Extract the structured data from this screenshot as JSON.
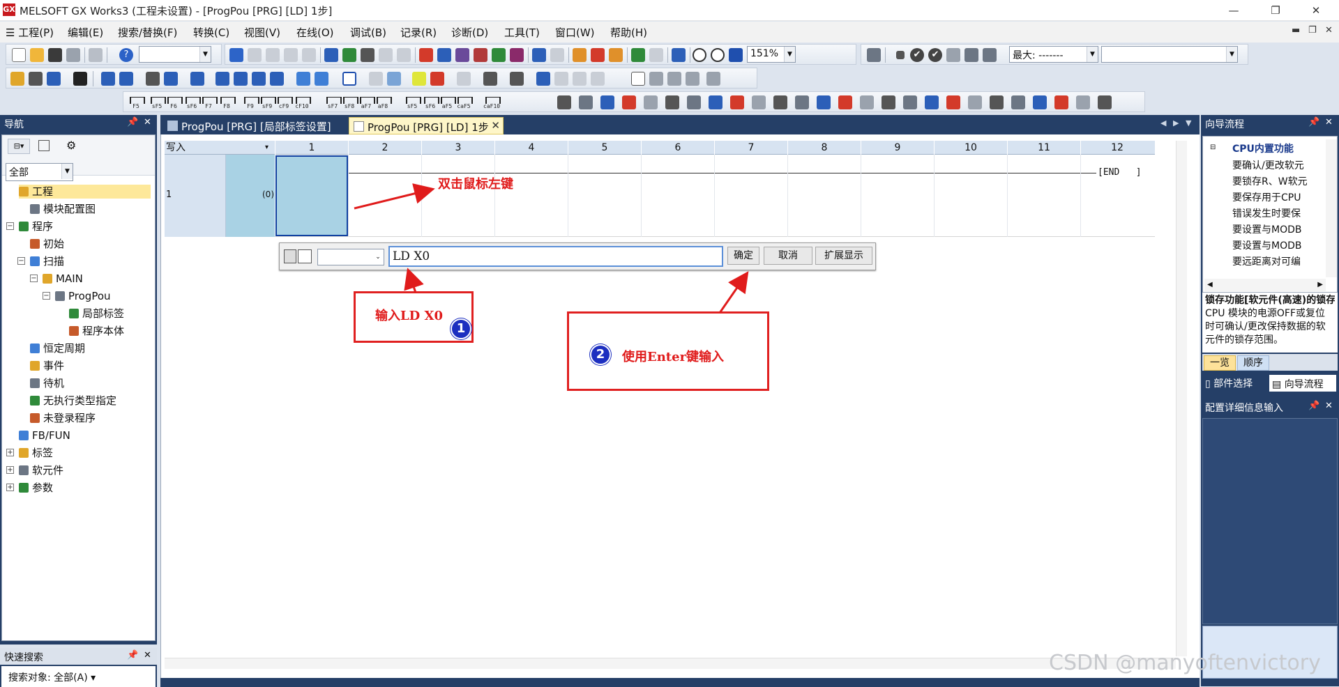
{
  "window": {
    "title": "MELSOFT GX Works3 (工程未设置) - [ProgPou [PRG] [LD] 1步]",
    "app_icon_text": "GX"
  },
  "menu": [
    "工程(P)",
    "编辑(E)",
    "搜索/替换(F)",
    "转换(C)",
    "视图(V)",
    "在线(O)",
    "调试(B)",
    "记录(R)",
    "诊断(D)",
    "工具(T)",
    "窗口(W)",
    "帮助(H)"
  ],
  "toolbar": {
    "zoom": "151%",
    "max_label": "最大: -------",
    "fkeys": [
      "F5",
      "sF5",
      "F6",
      "sF6",
      "F7",
      "F8",
      "F9",
      "sF9",
      "cF9",
      "cF10",
      "sF7",
      "sF8",
      "aF7",
      "aF8",
      "sF5",
      "sF6",
      "aF5",
      "caF5",
      "caF10"
    ]
  },
  "nav": {
    "title": "导航",
    "filter": "全部",
    "tree": [
      {
        "label": "工程",
        "level": 0,
        "selected": true
      },
      {
        "label": "模块配置图",
        "level": 1
      },
      {
        "label": "程序",
        "level": 0,
        "exp": "−"
      },
      {
        "label": "初始",
        "level": 1
      },
      {
        "label": "扫描",
        "level": 1,
        "exp": "−"
      },
      {
        "label": "MAIN",
        "level": 2,
        "exp": "−"
      },
      {
        "label": "ProgPou",
        "level": 3,
        "exp": "−"
      },
      {
        "label": "局部标签",
        "level": 4
      },
      {
        "label": "程序本体",
        "level": 4
      },
      {
        "label": "恒定周期",
        "level": 1
      },
      {
        "label": "事件",
        "level": 1
      },
      {
        "label": "待机",
        "level": 1
      },
      {
        "label": "无执行类型指定",
        "level": 1
      },
      {
        "label": "未登录程序",
        "level": 1
      },
      {
        "label": "FB/FUN",
        "level": 0
      },
      {
        "label": "标签",
        "level": 0,
        "exp": "+"
      },
      {
        "label": "软元件",
        "level": 0,
        "exp": "+"
      },
      {
        "label": "参数",
        "level": 0,
        "exp": "+"
      }
    ]
  },
  "quick_search": {
    "title": "快速搜索",
    "target": "搜索对象: 全部(A)"
  },
  "tabs": [
    {
      "label": "ProgPou [PRG] [局部标签设置]",
      "active": false
    },
    {
      "label": "ProgPou [PRG] [LD] 1步",
      "active": true
    }
  ],
  "ladder": {
    "write_label": "写入",
    "columns": [
      "1",
      "2",
      "3",
      "4",
      "5",
      "6",
      "7",
      "8",
      "9",
      "10",
      "11",
      "12"
    ],
    "row": "1",
    "step": "(0)",
    "end": "END"
  },
  "input": {
    "value": "LD X0",
    "ok": "确定",
    "cancel": "取消",
    "expand": "扩展显示"
  },
  "annotations": {
    "a1": "双击鼠标左键",
    "a2": "输入LD X0",
    "b1": "1",
    "a3": "使用Enter键输入",
    "b2": "2"
  },
  "guide": {
    "title": "向导流程",
    "group": "CPU内置功能",
    "items": [
      "要确认/更改软元",
      "要锁存R、W软元",
      "要保存用于CPU",
      "错误发生时要保",
      "要设置与MODB",
      "要设置与MODB",
      "要远距离对可编"
    ],
    "desc_title": "锁存功能[软元件(高速)的锁存",
    "desc": "CPU 模块的电源OFF或复位时可确认/更改保持数据的软元件的锁存范围。",
    "tab_list": "一览",
    "tab_order": "顺序",
    "bottom_tab1": "部件选择",
    "bottom_tab2": "向导流程"
  },
  "config": {
    "title": "配置详细信息输入"
  },
  "watermark": "CSDN @manyoftenvictory",
  "colors": {
    "panel": "#253f67",
    "cursor": "#a9d2e4",
    "annotation": "#e01b1b"
  }
}
